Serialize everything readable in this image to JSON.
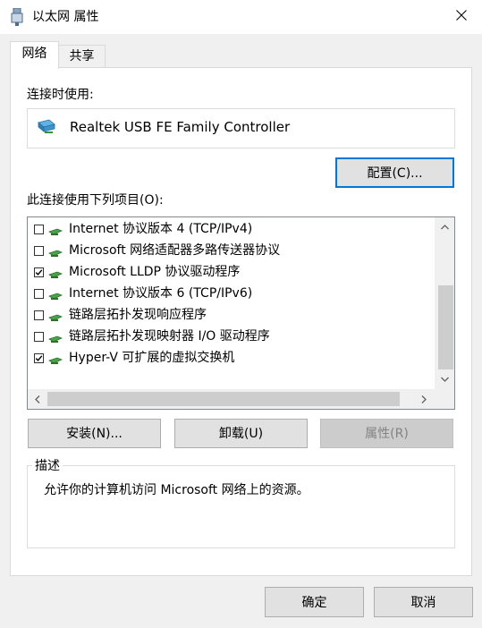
{
  "window": {
    "title": "以太网 属性"
  },
  "tabs": [
    {
      "label": "网络",
      "active": true
    },
    {
      "label": "共享",
      "active": false
    }
  ],
  "connect_using": {
    "label": "连接时使用:",
    "adapter": "Realtek USB FE Family Controller",
    "configure_button": "配置(C)..."
  },
  "items_section": {
    "label": "此连接使用下列项目(O):",
    "items": [
      {
        "label": "Internet 协议版本 4 (TCP/IPv4)",
        "checked": false
      },
      {
        "label": "Microsoft 网络适配器多路传送器协议",
        "checked": false
      },
      {
        "label": "Microsoft LLDP 协议驱动程序",
        "checked": true
      },
      {
        "label": "Internet 协议版本 6 (TCP/IPv6)",
        "checked": false
      },
      {
        "label": "链路层拓扑发现响应程序",
        "checked": false
      },
      {
        "label": "链路层拓扑发现映射器 I/O 驱动程序",
        "checked": false
      },
      {
        "label": "Hyper-V 可扩展的虚拟交换机",
        "checked": true
      }
    ]
  },
  "actions": {
    "install": "安装(N)...",
    "uninstall": "卸载(U)",
    "properties": "属性(R)"
  },
  "description": {
    "legend": "描述",
    "text": "允许你的计算机访问 Microsoft 网络上的资源。"
  },
  "footer": {
    "ok": "确定",
    "cancel": "取消"
  },
  "colors": {
    "accent": "#0078d7",
    "disabled_text": "#838383"
  }
}
